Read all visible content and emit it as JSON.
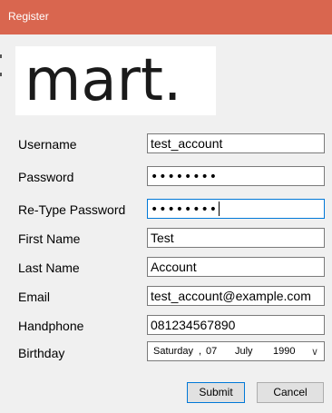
{
  "window": {
    "title": "Register"
  },
  "logo": {
    "text": "mart."
  },
  "form": {
    "username": {
      "label": "Username",
      "value": "test_account"
    },
    "password": {
      "label": "Password",
      "value": "••••••••"
    },
    "retype_password": {
      "label": "Re-Type Password",
      "value": "••••••••"
    },
    "first_name": {
      "label": "First Name",
      "value": "Test"
    },
    "last_name": {
      "label": "Last Name",
      "value": "Account"
    },
    "email": {
      "label": "Email",
      "value": "test_account@example.com"
    },
    "handphone": {
      "label": "Handphone",
      "value": "081234567890"
    },
    "birthday": {
      "label": "Birthday",
      "weekday": "Saturday",
      "separator": ",",
      "day": "07",
      "month": "July",
      "year": "1990",
      "dropdown_icon": "chevron-down-icon"
    }
  },
  "buttons": {
    "submit": "Submit",
    "cancel": "Cancel"
  },
  "colors": {
    "titlebar": "#d9664f",
    "focus_border": "#0078d7"
  }
}
